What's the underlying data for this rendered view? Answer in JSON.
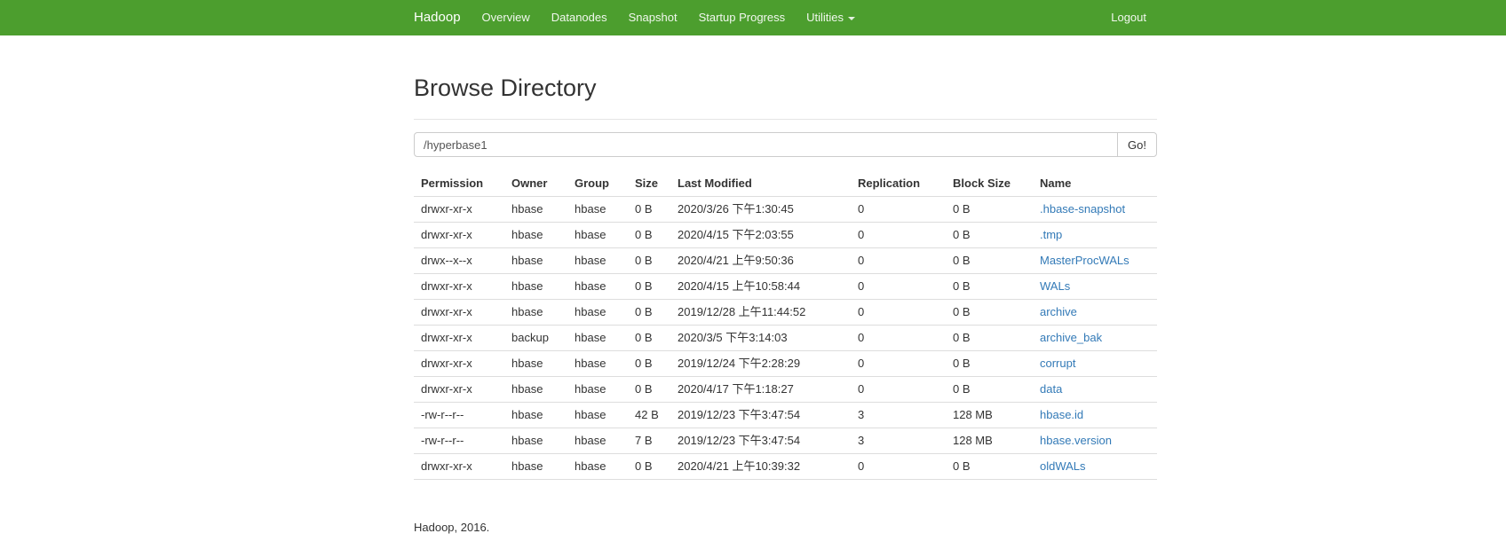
{
  "navbar": {
    "brand": "Hadoop",
    "items": [
      {
        "label": "Overview"
      },
      {
        "label": "Datanodes"
      },
      {
        "label": "Snapshot"
      },
      {
        "label": "Startup Progress"
      },
      {
        "label": "Utilities",
        "has_dropdown": true
      }
    ],
    "logout_label": "Logout",
    "bg_color": "#4c9e2e"
  },
  "main": {
    "title": "Browse Directory",
    "path_input": {
      "value": "/hyperbase1"
    },
    "go_button_label": "Go!"
  },
  "table": {
    "columns": [
      "Permission",
      "Owner",
      "Group",
      "Size",
      "Last Modified",
      "Replication",
      "Block Size",
      "Name"
    ],
    "link_color": "#337ab7",
    "rows": [
      [
        "drwxr-xr-x",
        "hbase",
        "hbase",
        "0 B",
        "2020/3/26 下午1:30:45",
        "0",
        "0 B",
        ".hbase-snapshot"
      ],
      [
        "drwxr-xr-x",
        "hbase",
        "hbase",
        "0 B",
        "2020/4/15 下午2:03:55",
        "0",
        "0 B",
        ".tmp"
      ],
      [
        "drwx--x--x",
        "hbase",
        "hbase",
        "0 B",
        "2020/4/21 上午9:50:36",
        "0",
        "0 B",
        "MasterProcWALs"
      ],
      [
        "drwxr-xr-x",
        "hbase",
        "hbase",
        "0 B",
        "2020/4/15 上午10:58:44",
        "0",
        "0 B",
        "WALs"
      ],
      [
        "drwxr-xr-x",
        "hbase",
        "hbase",
        "0 B",
        "2019/12/28 上午11:44:52",
        "0",
        "0 B",
        "archive"
      ],
      [
        "drwxr-xr-x",
        "backup",
        "hbase",
        "0 B",
        "2020/3/5 下午3:14:03",
        "0",
        "0 B",
        "archive_bak"
      ],
      [
        "drwxr-xr-x",
        "hbase",
        "hbase",
        "0 B",
        "2019/12/24 下午2:28:29",
        "0",
        "0 B",
        "corrupt"
      ],
      [
        "drwxr-xr-x",
        "hbase",
        "hbase",
        "0 B",
        "2020/4/17 下午1:18:27",
        "0",
        "0 B",
        "data"
      ],
      [
        "-rw-r--r--",
        "hbase",
        "hbase",
        "42 B",
        "2019/12/23 下午3:47:54",
        "3",
        "128 MB",
        "hbase.id"
      ],
      [
        "-rw-r--r--",
        "hbase",
        "hbase",
        "7 B",
        "2019/12/23 下午3:47:54",
        "3",
        "128 MB",
        "hbase.version"
      ],
      [
        "drwxr-xr-x",
        "hbase",
        "hbase",
        "0 B",
        "2020/4/21 上午10:39:32",
        "0",
        "0 B",
        "oldWALs"
      ]
    ]
  },
  "footer": {
    "text": "Hadoop, 2016."
  }
}
